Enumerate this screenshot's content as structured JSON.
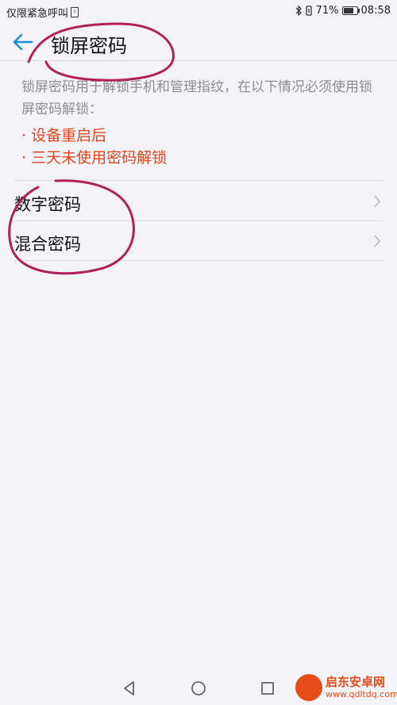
{
  "status_bar": {
    "carrier_text": "仅限紧急呼叫",
    "battery_percent": "71%",
    "time": "08:58"
  },
  "header": {
    "title": "锁屏密码"
  },
  "description": {
    "text": "锁屏密码用于解锁手机和管理指纹，在以下情况必须使用锁屏密码解锁：",
    "conditions": [
      "· 设备重启后",
      "· 三天未使用密码解锁"
    ],
    "condition_color": "#e0451f"
  },
  "options": [
    {
      "label": "数字密码"
    },
    {
      "label": "混合密码"
    }
  ],
  "nav_bar": {
    "buttons": [
      "back-triangle-icon",
      "home-circle-icon",
      "recents-square-icon"
    ]
  },
  "watermark": {
    "name": "启东安卓网",
    "url": "www.qdltdq.com"
  },
  "colors": {
    "accent": "#1a8fd6",
    "annotation": "#b0205a"
  }
}
